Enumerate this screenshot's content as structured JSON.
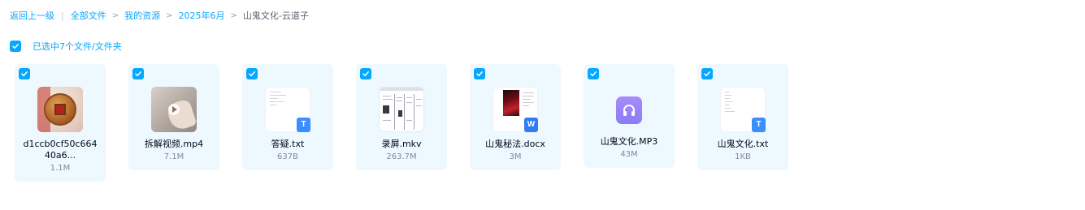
{
  "breadcrumb": {
    "back": "返回上一级",
    "items": [
      "全部文件",
      "我的资源",
      "2025年6月"
    ],
    "current": "山鬼文化-云道子"
  },
  "selection": {
    "label": "已选中7个文件/文件夹"
  },
  "files": [
    {
      "name": "d1ccb0cf50c664 40a6...",
      "size": "1.1M",
      "thumb": "image-coin"
    },
    {
      "name": "拆解视频.mp4",
      "size": "7.1M",
      "thumb": "video"
    },
    {
      "name": "答疑.txt",
      "size": "637B",
      "thumb": "txt",
      "badge": "T"
    },
    {
      "name": "录屏.mkv",
      "size": "263.7M",
      "thumb": "screen-recording"
    },
    {
      "name": "山鬼秘法.docx",
      "size": "3M",
      "thumb": "docx",
      "badge": "W"
    },
    {
      "name": "山鬼文化.MP3",
      "size": "43M",
      "thumb": "audio-icon"
    },
    {
      "name": "山鬼文化.txt",
      "size": "1KB",
      "thumb": "txt",
      "badge": "T"
    }
  ],
  "colors": {
    "accent": "#06a7ff",
    "card_bg": "#eef8ff",
    "muted": "#818999"
  }
}
